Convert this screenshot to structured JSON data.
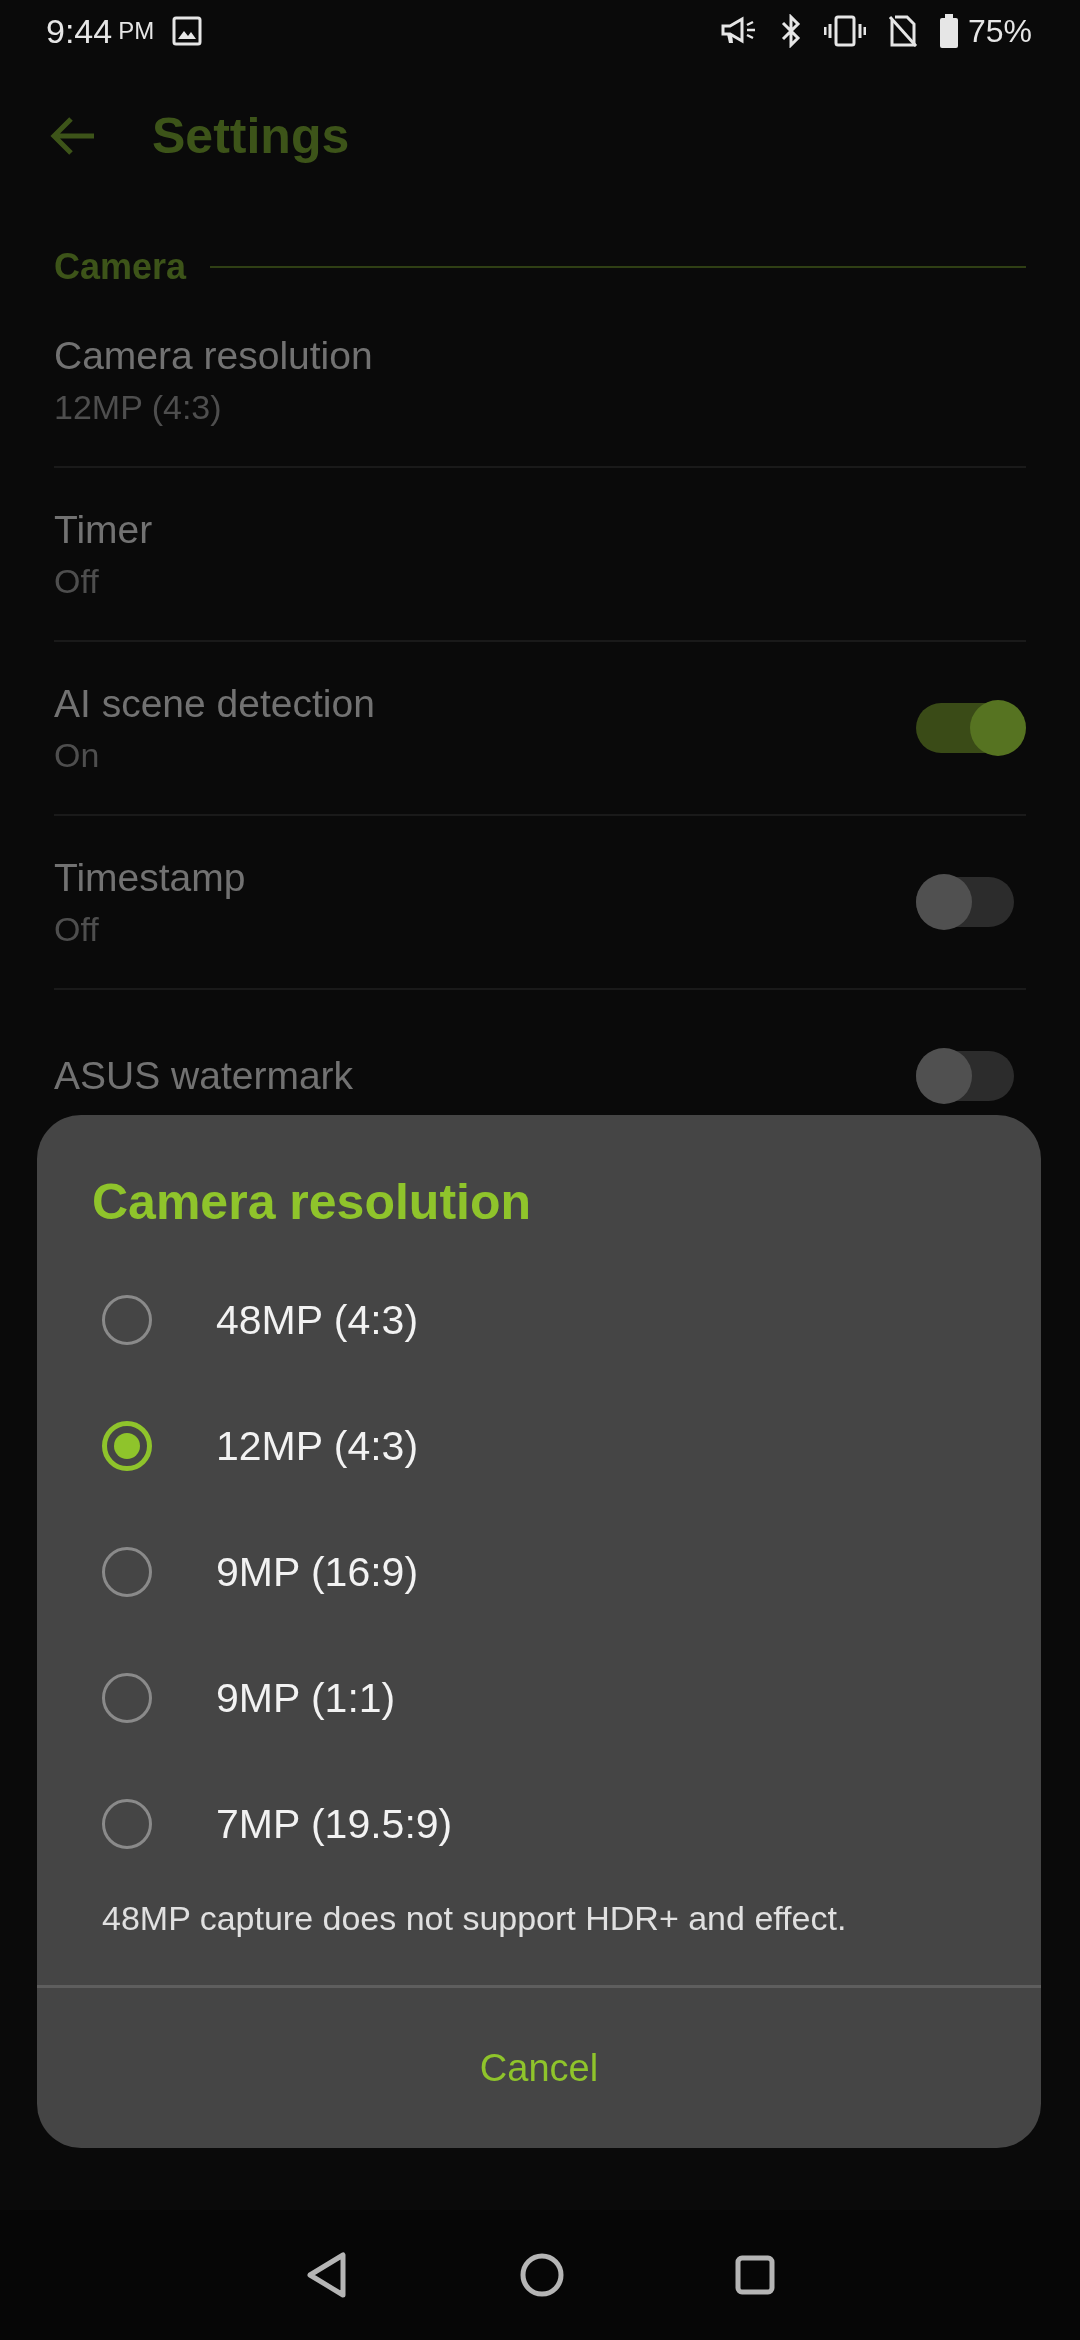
{
  "status_bar": {
    "time": "9:44",
    "ampm": "PM",
    "battery": "75%"
  },
  "toolbar": {
    "title": "Settings"
  },
  "section": {
    "title": "Camera"
  },
  "settings": [
    {
      "kind": "value",
      "title": "Camera resolution",
      "value": "12MP (4:3)"
    },
    {
      "kind": "value",
      "title": "Timer",
      "value": "Off"
    },
    {
      "kind": "toggle",
      "title": "AI scene detection",
      "value": "On",
      "on": true
    },
    {
      "kind": "toggle",
      "title": "Timestamp",
      "value": "Off",
      "on": false
    },
    {
      "kind": "toggle",
      "title": "ASUS watermark",
      "on": false
    }
  ],
  "dialog": {
    "title": "Camera resolution",
    "options": [
      {
        "label": "48MP (4:3)",
        "selected": false
      },
      {
        "label": "12MP (4:3)",
        "selected": true
      },
      {
        "label": "9MP (16:9)",
        "selected": false
      },
      {
        "label": "9MP (1:1)",
        "selected": false
      },
      {
        "label": "7MP (19.5:9)",
        "selected": false
      }
    ],
    "note": "48MP capture does not support HDR+ and effect.",
    "button": "Cancel"
  }
}
